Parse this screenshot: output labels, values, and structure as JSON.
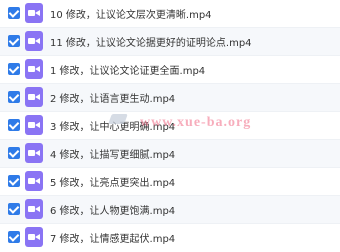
{
  "files": [
    {
      "name": "10 修改，让议论文层次更清晰.mp4",
      "checked": true
    },
    {
      "name": "11 修改，让议论文论据更好的证明论点.mp4",
      "checked": true
    },
    {
      "name": "1 修改，让议论文论证更全面.mp4",
      "checked": true
    },
    {
      "name": "2 修改，让语言更生动.mp4",
      "checked": true
    },
    {
      "name": "3 修改，让中心更明确.mp4",
      "checked": true
    },
    {
      "name": "4 修改，让描写更细腻.mp4",
      "checked": true
    },
    {
      "name": "5 修改，让亮点更突出.mp4",
      "checked": true
    },
    {
      "name": "6 修改，让人物更饱满.mp4",
      "checked": true
    },
    {
      "name": "7 修改，让情感更起伏.mp4",
      "checked": true
    }
  ],
  "icons": {
    "checkbox": "checkbox-checked-icon",
    "file": "video-file-icon"
  },
  "colors": {
    "checkbox": "#2f7be8",
    "video_icon": "#8a74f4",
    "text": "#333333"
  },
  "watermark": {
    "text": "www.xue-ba.org"
  }
}
